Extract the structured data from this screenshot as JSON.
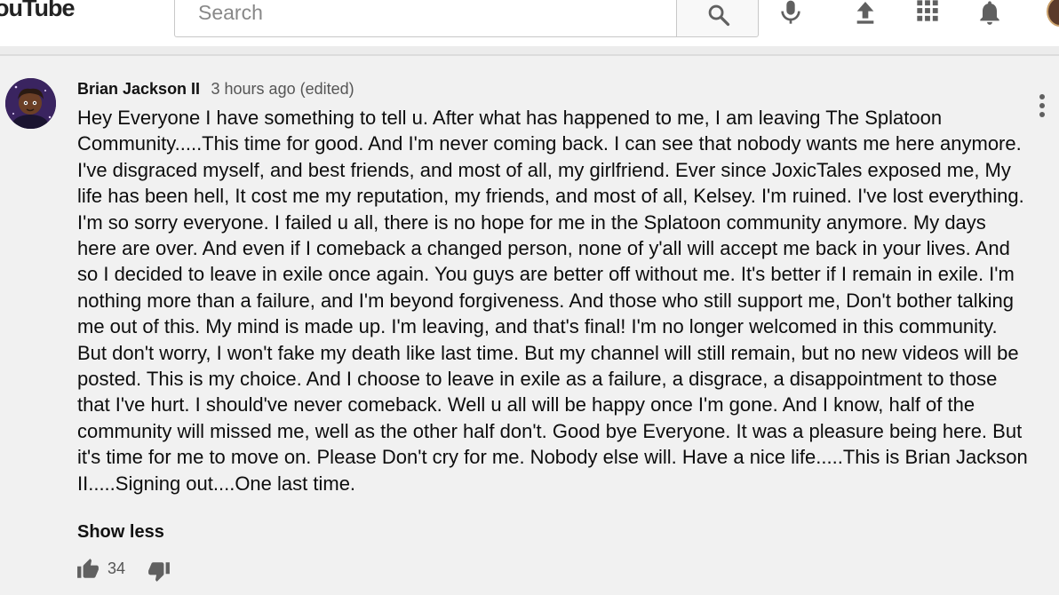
{
  "masthead": {
    "logo_text": "ouTube",
    "search_placeholder": "Search",
    "icons": [
      "search-icon",
      "mic-icon",
      "upload-icon",
      "apps-grid-icon",
      "notifications-bell-icon",
      "account-avatar"
    ]
  },
  "comment": {
    "author": "Brian Jackson II",
    "timestamp": "3 hours ago (edited)",
    "text": "Hey Everyone I have something to tell u. After what has happened to me, I am leaving The Splatoon Community.....This time for good. And I'm never coming back. I can see that nobody wants me here anymore. I've disgraced myself, and best friends, and most of all, my girlfriend. Ever since JoxicTales exposed me, My life has been hell, It cost me my reputation, my friends, and most of all, Kelsey. I'm ruined. I've lost everything. I'm so sorry everyone. I failed u all, there is no hope for me in the Splatoon community anymore. My days here are over. And even if I comeback a changed person, none of y'all will accept me back in your lives. And so I decided to leave in exile once again. You guys are better off without me. It's better if I remain in exile. I'm nothing more than a failure, and I'm beyond forgiveness. And those who still support me, Don't bother talking me out of this. My mind is made up. I'm leaving, and that's final! I'm no longer welcomed in this community. But don't worry, I won't fake my death like last time. But my channel will still remain, but no new videos will be posted. This is my choice. And I choose to leave in exile as a failure, a disgrace, a disappointment to those that I've hurt. I should've never comeback. Well u all will be happy once I'm gone. And I know, half of the community will missed me, well as the other half don't. Good bye Everyone. It was a pleasure being here. But it's time for me to move on. Please Don't cry for me. Nobody else will. Have a nice life.....This is Brian Jackson II.....Signing out....One last time.",
    "show_less_label": "Show less",
    "like_count": "34"
  },
  "colors": {
    "page_background": "#f1f1f1",
    "masthead_background": "#ffffff",
    "icon_gray": "#606060",
    "text_primary": "#111111",
    "text_secondary": "#555555"
  }
}
